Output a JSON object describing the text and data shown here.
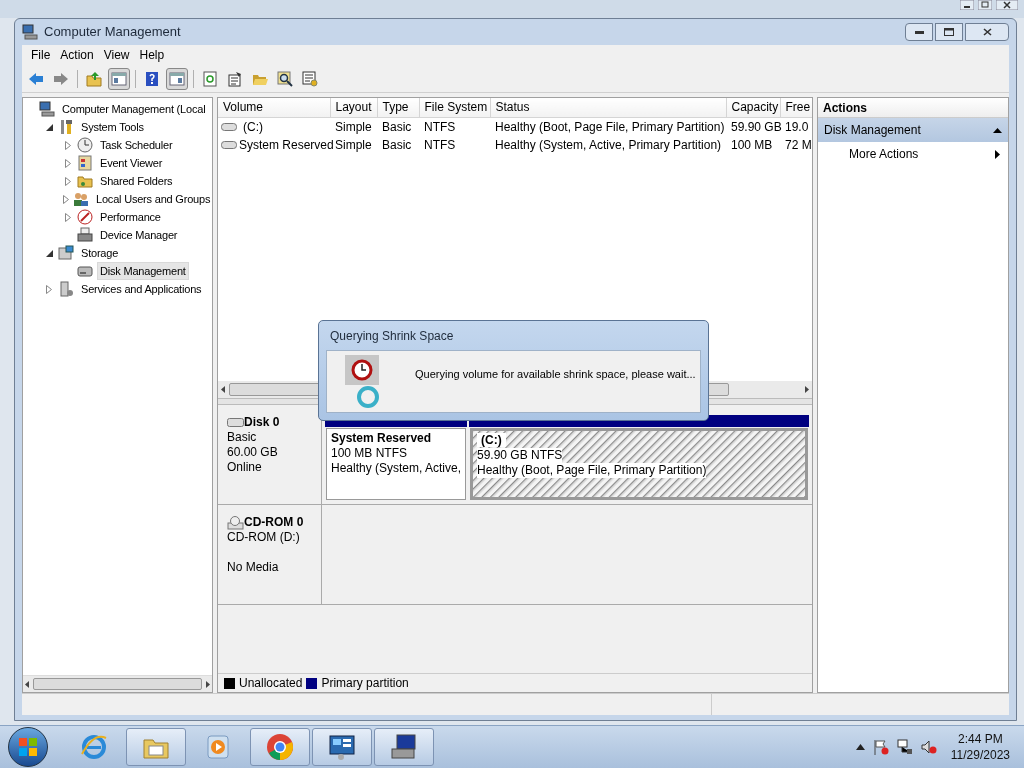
{
  "window": {
    "title": "Computer Management"
  },
  "menu": [
    "File",
    "Action",
    "View",
    "Help"
  ],
  "toolbar": [
    {
      "kind": "back",
      "pressed": false
    },
    {
      "kind": "forward",
      "pressed": false
    },
    {
      "kind": "sep"
    },
    {
      "kind": "up",
      "pressed": false
    },
    {
      "kind": "tree-pane",
      "pressed": true
    },
    {
      "kind": "sep"
    },
    {
      "kind": "help",
      "pressed": false
    },
    {
      "kind": "action-pane",
      "pressed": true
    },
    {
      "kind": "sep"
    },
    {
      "kind": "refresh",
      "pressed": false
    },
    {
      "kind": "properties",
      "pressed": false
    },
    {
      "kind": "open",
      "pressed": false
    },
    {
      "kind": "search",
      "pressed": false
    },
    {
      "kind": "settings",
      "pressed": false
    }
  ],
  "tree": [
    {
      "label": "Computer Management (Local",
      "kind": "computer",
      "selected": false,
      "children": [
        {
          "label": "System Tools",
          "kind": "tools",
          "expanded": true,
          "selected": false,
          "children": [
            {
              "label": "Task Scheduler",
              "kind": "clock",
              "expanded": false,
              "selected": false
            },
            {
              "label": "Event Viewer",
              "kind": "log",
              "expanded": false,
              "selected": false
            },
            {
              "label": "Shared Folders",
              "kind": "share",
              "expanded": false,
              "selected": false
            },
            {
              "label": "Local Users and Groups",
              "kind": "users",
              "expanded": false,
              "selected": false
            },
            {
              "label": "Performance",
              "kind": "perf",
              "expanded": false,
              "selected": false
            },
            {
              "label": "Device Manager",
              "kind": "device",
              "selected": false
            }
          ]
        },
        {
          "label": "Storage",
          "kind": "storage",
          "expanded": true,
          "selected": false,
          "children": [
            {
              "label": "Disk Management",
              "kind": "disk",
              "selected": true
            }
          ]
        },
        {
          "label": "Services and Applications",
          "kind": "services",
          "expanded": false,
          "selected": false
        }
      ]
    }
  ],
  "table": {
    "columns": [
      "Volume",
      "Layout",
      "Type",
      "File System",
      "Status",
      "Capacity",
      "Free"
    ],
    "rows": [
      [
        "(C:)",
        "Simple",
        "Basic",
        "NTFS",
        "Healthy (Boot, Page File, Primary Partition)",
        "59.90 GB",
        "19.0"
      ],
      [
        "System Reserved",
        "Simple",
        "Basic",
        "NTFS",
        "Healthy (System, Active, Primary Partition)",
        "100 MB",
        "72 M"
      ]
    ]
  },
  "disks": [
    {
      "kind": "disk",
      "name": "Disk 0",
      "lines": [
        "Basic",
        "60.00 GB",
        "Online"
      ],
      "partitions": [
        {
          "name": "System Reserved",
          "size": "100 MB NTFS",
          "status": "Healthy (System, Active,",
          "selected": false
        },
        {
          "name": "(C:)",
          "size": "59.90 GB NTFS",
          "status": "Healthy (Boot, Page File, Primary Partition)",
          "selected": true
        }
      ]
    },
    {
      "kind": "cdrom",
      "name": "CD-ROM 0",
      "lines": [
        "CD-ROM (D:)",
        "No Media"
      ]
    }
  ],
  "legend": [
    {
      "label": "Unallocated",
      "color": "#000000"
    },
    {
      "label": "Primary partition",
      "color": "#000080"
    }
  ],
  "actions": {
    "title": "Actions",
    "section": {
      "label": "Disk Management",
      "expanded": true
    },
    "items": [
      "More Actions"
    ]
  },
  "dialog": {
    "title": "Querying Shrink Space",
    "message": "Querying volume for available shrink space, please wait..."
  },
  "taskbar": {
    "apps": [
      {
        "kind": "ie",
        "running": false
      },
      {
        "kind": "explorer",
        "running": true
      },
      {
        "kind": "media",
        "running": false
      },
      {
        "kind": "chrome",
        "running": true
      },
      {
        "kind": "control",
        "running": true
      },
      {
        "kind": "compmgmt",
        "running": true
      }
    ],
    "time": "2:44 PM",
    "date": "11/29/2023"
  }
}
